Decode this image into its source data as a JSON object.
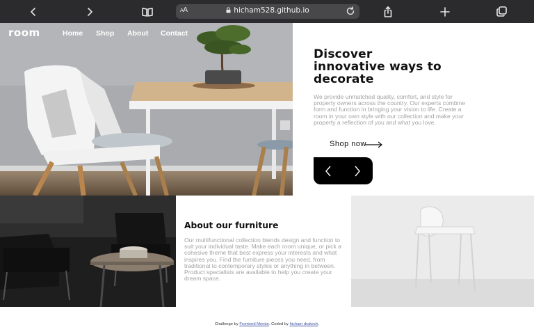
{
  "browser": {
    "text_size_label_small": "A",
    "text_size_label_large": "A",
    "url": "hicham528.github.io"
  },
  "nav": {
    "logo": "room",
    "links": [
      "Home",
      "Shop",
      "About",
      "Contact"
    ]
  },
  "hero": {
    "title": "Discover innovative ways to decorate",
    "description": "We provide unmatched quality, comfort, and style for property owners across the country. Our experts combine form and function in bringing your vision to life. Create a room in your own style with our collection and make your property a reflection of you and what you love.",
    "cta": "Shop now"
  },
  "about": {
    "title": "About our furniture",
    "description": "Our multifunctional collection blends design and function to suit your individual taste. Make each room unique, or pick a cohesive theme that best express your interests and what inspires you. Find the furniture pieces you need, from traditional to contemporary styles or anything in between. Product specialists are available to help you create your dream space."
  },
  "footer": {
    "prefix": "Challenge by",
    "link1": "Frontend Mentor",
    "middle": ". Coded by",
    "link2": "hicham drakech",
    "suffix": "."
  }
}
